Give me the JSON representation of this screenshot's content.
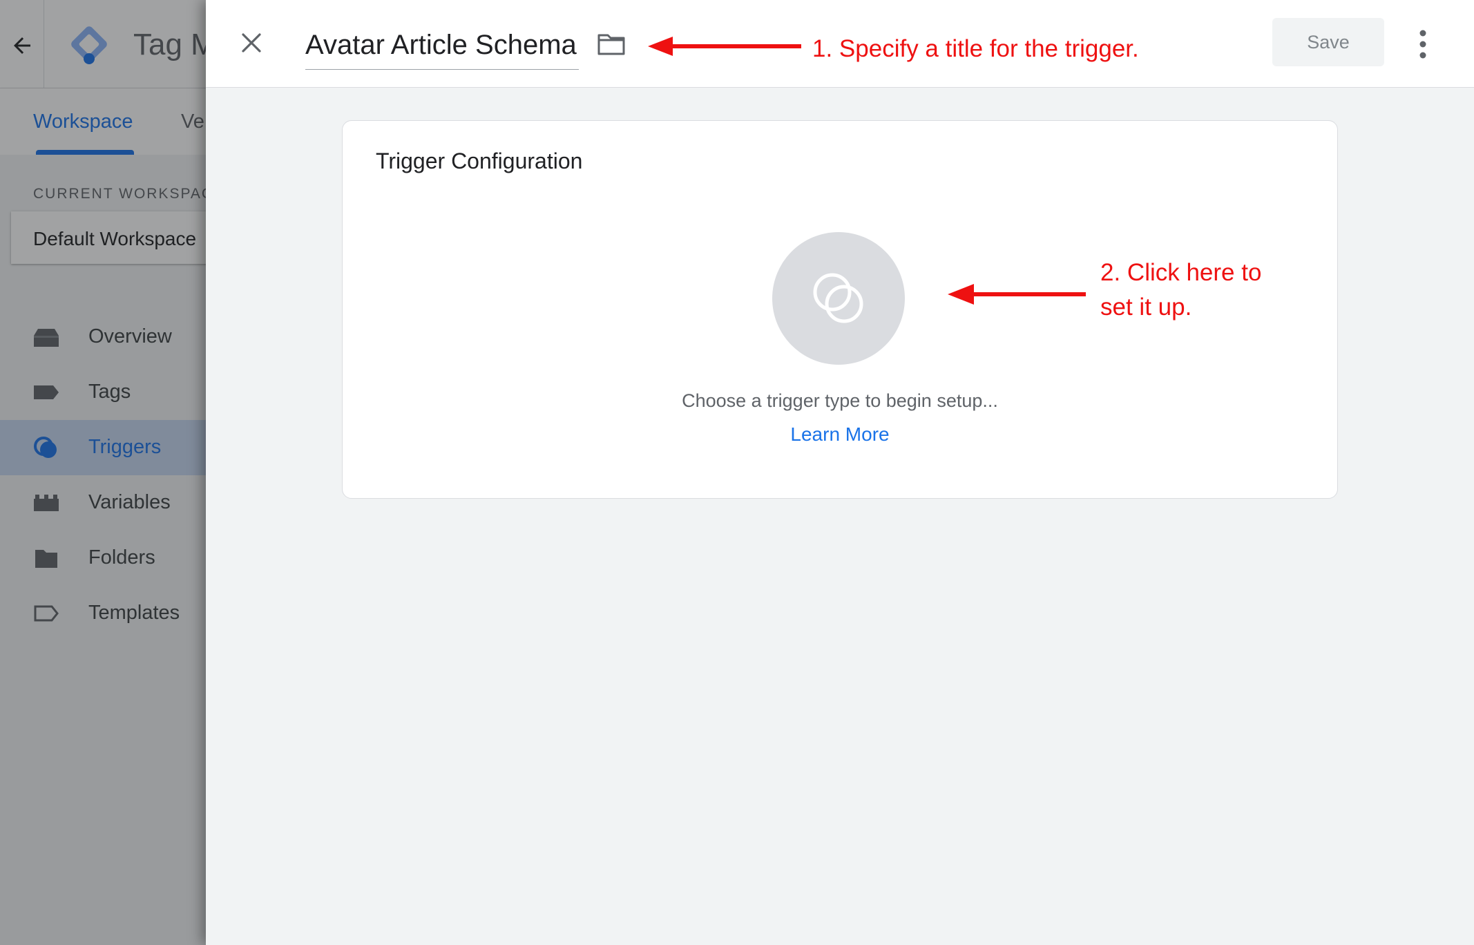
{
  "background_app": {
    "title": "Tag M",
    "tabs": [
      {
        "label": "Workspace",
        "active": true
      },
      {
        "label": "Ve",
        "active": false
      }
    ],
    "current_workspace_label": "CURRENT WORKSPACE",
    "current_workspace_name": "Default Workspace",
    "nav": [
      {
        "label": "Overview",
        "icon": "overview-icon",
        "active": false
      },
      {
        "label": "Tags",
        "icon": "tag-icon",
        "active": false
      },
      {
        "label": "Triggers",
        "icon": "trigger-icon",
        "active": true
      },
      {
        "label": "Variables",
        "icon": "variables-icon",
        "active": false
      },
      {
        "label": "Folders",
        "icon": "folder-icon",
        "active": false
      },
      {
        "label": "Templates",
        "icon": "templates-icon",
        "active": false
      }
    ]
  },
  "editor": {
    "trigger_name": "Avatar Article Schema",
    "save_label": "Save",
    "card_title": "Trigger Configuration",
    "choose_text": "Choose a trigger type to begin setup...",
    "learn_more": "Learn More"
  },
  "annotations": {
    "step1": "1. Specify a title for the trigger.",
    "step2_line1": "2. Click here to",
    "step2_line2": "set it up."
  },
  "colors": {
    "accent": "#1a73e8",
    "annotation": "#ee1111",
    "scrim": "rgba(32,33,36,0.42)"
  }
}
